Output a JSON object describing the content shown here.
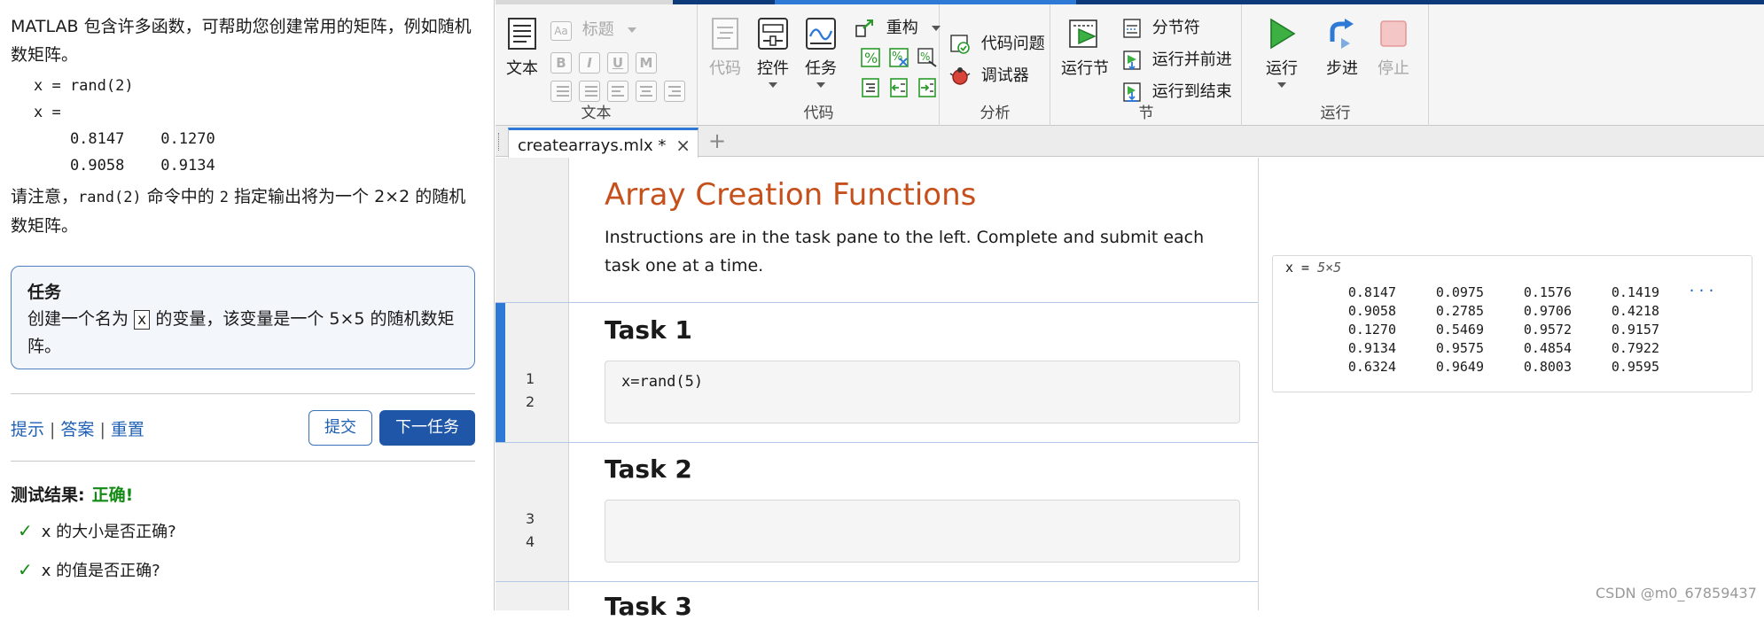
{
  "task_pane": {
    "intro": "MATLAB 包含许多函数，可帮助您创建常用的矩阵，例如随机数矩阵。",
    "code_lines": [
      "x = rand(2)",
      "x =",
      "    0.8147    0.1270",
      "    0.9058    0.9134"
    ],
    "note_before": "请注意，",
    "note_code1": "rand(2)",
    "note_mid": " 命令中的 ",
    "note_code2": "2",
    "note_after": " 指定输出将为一个 2×2 的随机数矩阵。",
    "task_title": "任务",
    "task_before": "创建一个名为 ",
    "task_var": "x",
    "task_after": " 的变量，该变量是一个 5×5 的随机数矩阵。",
    "link_hint": "提示",
    "link_answer": "答案",
    "link_reset": "重置",
    "submit_label": "提交",
    "next_label": "下一任务",
    "result_label": "测试结果:",
    "result_status": "正确!",
    "checks": [
      "x 的大小是否正确?",
      "x 的值是否正确?"
    ]
  },
  "toolstrip": {
    "text_group": {
      "label": "文本",
      "text_button": "文本",
      "style_label": "标题",
      "format_buttons": [
        "B",
        "I",
        "U",
        "M"
      ]
    },
    "code_group": {
      "label": "代码",
      "code_button": "代码",
      "controls_button": "控件",
      "tasks_button": "任务",
      "refactor_button": "重构"
    },
    "analyze_group": {
      "label": "分析",
      "code_issues": "代码问题",
      "debugger": "调试器"
    },
    "section_group": {
      "label": "节",
      "run_section": "运行节",
      "section_break": "分节符",
      "run_and_advance": "运行并前进",
      "run_to_end": "运行到结束"
    },
    "run_group": {
      "label": "运行",
      "run_button": "运行",
      "step_button": "步进",
      "stop_button": "停止"
    }
  },
  "tabs": {
    "active_file": "createarrays.mlx *",
    "add_tab": "+"
  },
  "editor": {
    "title": "Array Creation Functions",
    "instructions": "Instructions are in the task pane to the left. Complete and submit each task one at a time.",
    "task1_heading": "Task 1",
    "task1_code": "x=rand(5)",
    "task2_heading": "Task 2",
    "task3_heading": "Task 3",
    "line_numbers": [
      "1",
      "2",
      "3",
      "4"
    ]
  },
  "output": {
    "var_name": "x",
    "eq": " = ",
    "size": "5×5",
    "rows": [
      [
        "0.8147",
        "0.0975",
        "0.1576",
        "0.1419"
      ],
      [
        "0.9058",
        "0.2785",
        "0.9706",
        "0.4218"
      ],
      [
        "0.1270",
        "0.5469",
        "0.9572",
        "0.9157"
      ],
      [
        "0.9134",
        "0.9575",
        "0.4854",
        "0.7922"
      ],
      [
        "0.6324",
        "0.9649",
        "0.8003",
        "0.9595"
      ]
    ],
    "more": "···"
  },
  "watermark": "CSDN @m0_67859437",
  "colors": {
    "title_orange": "#c6501c",
    "accent_blue": "#2d79d5",
    "next_button": "#1f56a8",
    "pass_green": "#138a13"
  }
}
